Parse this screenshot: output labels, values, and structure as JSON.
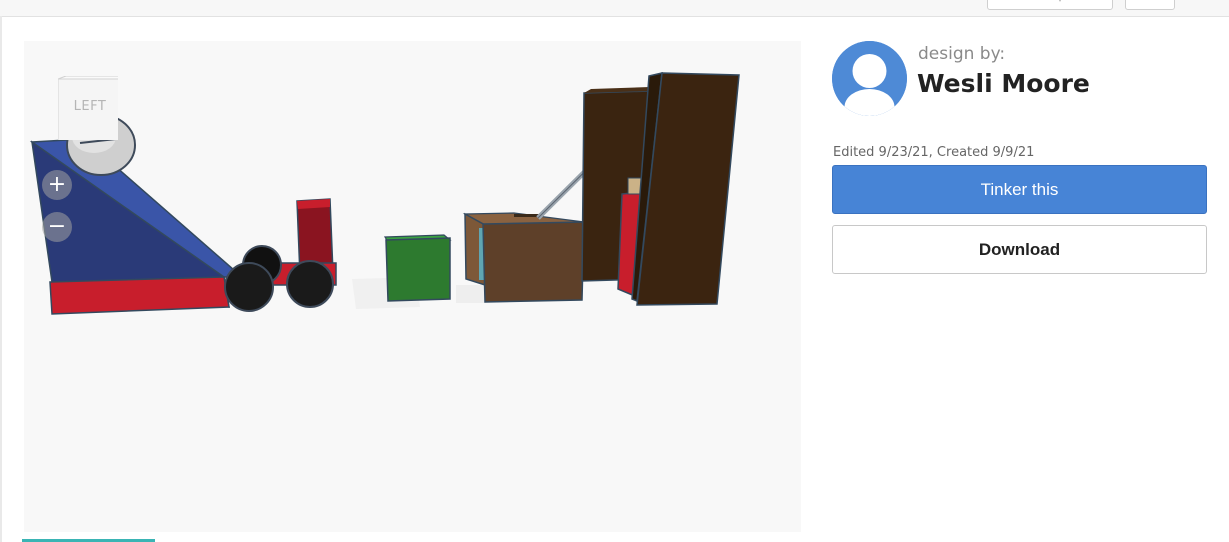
{
  "viewer": {
    "viewcube_face": "LEFT",
    "zoom_in_label": "+",
    "zoom_out_label": "−"
  },
  "designer": {
    "design_by_label": "design by:",
    "name": "Wesli Moore",
    "avatar_icon": "user-avatar-icon",
    "avatar_color": "#4e8ad6"
  },
  "dates": "Edited 9/23/21, Created 9/9/21",
  "actions": {
    "tinker_label": "Tinker this",
    "download_label": "Download"
  },
  "colors": {
    "primary_button": "#4784d6",
    "accent_tab": "#3ab4b4"
  }
}
